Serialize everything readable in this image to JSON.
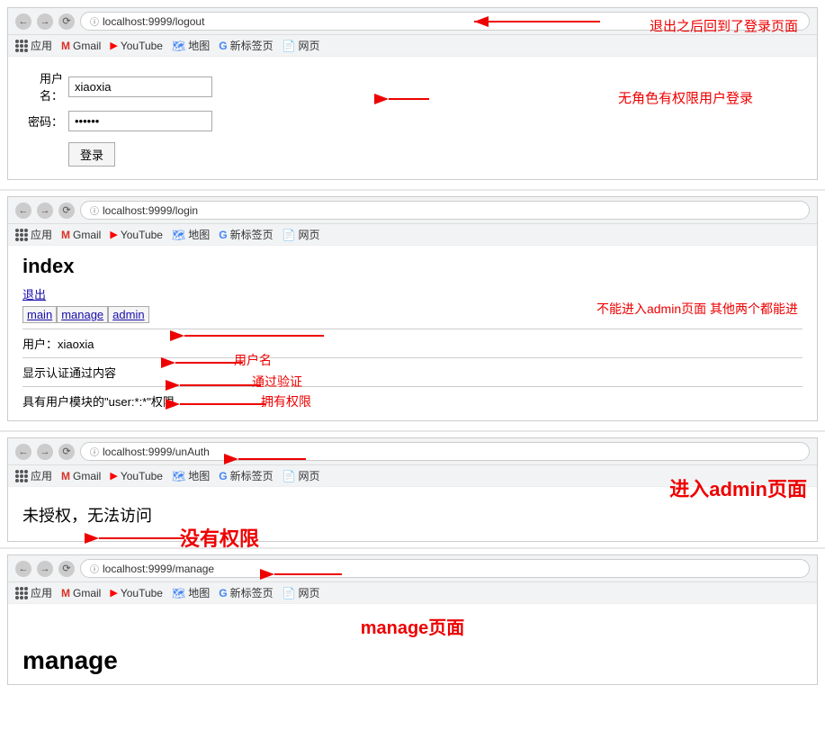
{
  "annotations": {
    "logout_note": "退出之后回到了登录页面",
    "no_role_note": "无角色有权限用户登录",
    "index_title": "index",
    "logout_link": "退出",
    "nav_main": "main",
    "nav_manage": "manage",
    "nav_admin": "admin",
    "user_label": "用户：xiaoxia",
    "username_note": "用户名",
    "auth_label": "显示认证通过内容",
    "auth_note": "通过验证",
    "permission_label": "具有用户模块的\"user:*:*\"权限",
    "permission_note": "拥有权限",
    "cant_admin_note": "不能进入admin页面 其他两个都能进",
    "unauth_text": "未授权，无法访问",
    "unauth_note": "没有权限",
    "admin_note": "进入admin页面",
    "manage_title": "manage",
    "manage_note": "manage页面",
    "urls": {
      "logout": "localhost:9999/logout",
      "login": "localhost:9999/login",
      "unauth": "localhost:9999/unAuth",
      "manage": "localhost:9999/manage"
    },
    "bookmarks": {
      "apps": "应用",
      "gmail": "Gmail",
      "youtube": "YouTube",
      "maps": "地图",
      "google": "新标签页",
      "web": "网页"
    },
    "login": {
      "username_label": "用户名：",
      "password_label": "密码：",
      "username_value": "xiaoxia",
      "password_value": "••••••",
      "button": "登录"
    }
  }
}
